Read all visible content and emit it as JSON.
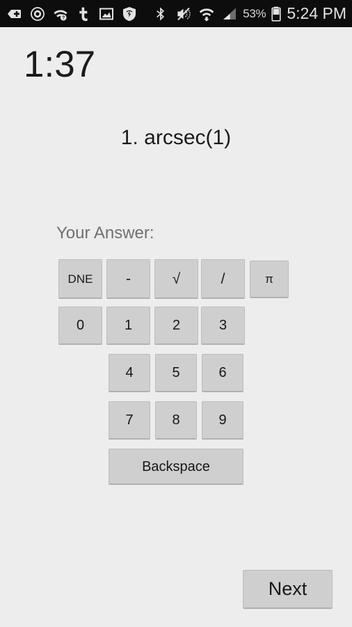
{
  "status_bar": {
    "background": "#0d0d0d",
    "left_icons": [
      {
        "name": "add-tag-icon",
        "glyph": "plus-in-pennant"
      },
      {
        "name": "record-circle-icon",
        "glyph": "double-circle"
      },
      {
        "name": "wifi-question-icon",
        "glyph": "wifi-help"
      },
      {
        "name": "contacts-icon",
        "glyph": "tango-contact"
      },
      {
        "name": "gallery-image-icon",
        "glyph": "picture-frame"
      },
      {
        "name": "shield-security-icon",
        "glyph": "shield-refresh"
      },
      {
        "name": "bluetooth-icon",
        "glyph": "bluetooth"
      },
      {
        "name": "mute-vibrate-icon",
        "glyph": "speaker-muted"
      },
      {
        "name": "wifi-download-icon",
        "glyph": "wifi-arrow-down"
      },
      {
        "name": "cell-signal-icon",
        "glyph": "signal-bars"
      }
    ],
    "battery_percent": "53%",
    "battery_icon": "battery-half-icon",
    "clock": "5:24 PM"
  },
  "timer": {
    "value": "1:37"
  },
  "question": {
    "text": "1. arcsec(1)"
  },
  "answer": {
    "label": "Your Answer:",
    "value": ""
  },
  "keypad": {
    "row1": [
      {
        "label": "DNE",
        "name": "key-dne"
      },
      {
        "label": "-",
        "name": "key-minus"
      },
      {
        "label": "√",
        "name": "key-sqrt"
      },
      {
        "label": "/",
        "name": "key-divide"
      },
      {
        "label": "π",
        "name": "key-pi"
      }
    ],
    "row2": [
      {
        "label": "0",
        "name": "key-0"
      },
      {
        "label": "1",
        "name": "key-1"
      },
      {
        "label": "2",
        "name": "key-2"
      },
      {
        "label": "3",
        "name": "key-3"
      }
    ],
    "row3": [
      {
        "label": "4",
        "name": "key-4"
      },
      {
        "label": "5",
        "name": "key-5"
      },
      {
        "label": "6",
        "name": "key-6"
      }
    ],
    "row4": [
      {
        "label": "7",
        "name": "key-7"
      },
      {
        "label": "8",
        "name": "key-8"
      },
      {
        "label": "9",
        "name": "key-9"
      }
    ],
    "backspace": {
      "label": "Backspace",
      "name": "key-backspace"
    }
  },
  "footer": {
    "next_label": "Next"
  },
  "colors": {
    "page_background": "#ededed",
    "key_face": "#cfcfcf",
    "key_border": "#bdbdbd",
    "text_primary": "#171717",
    "text_muted": "#707070",
    "status_bar_bg": "#0d0d0d"
  }
}
